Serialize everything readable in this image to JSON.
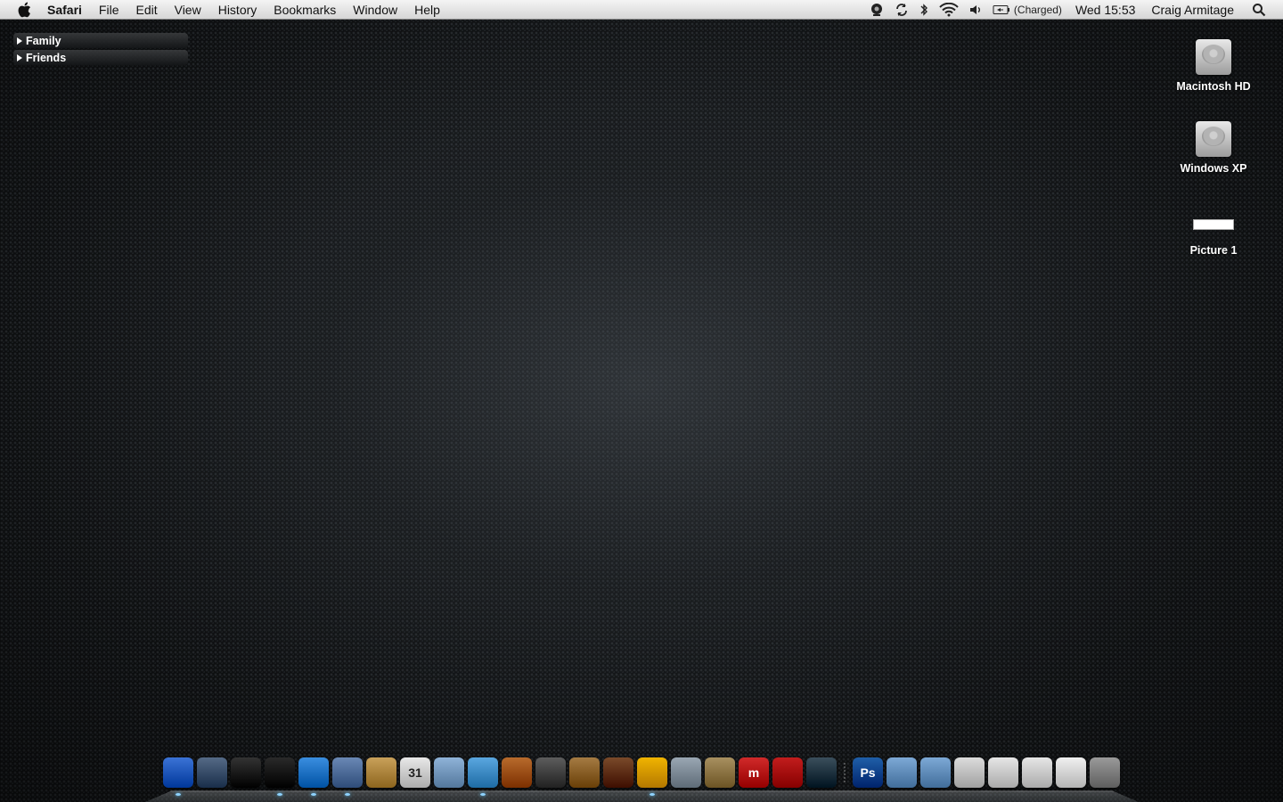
{
  "menubar": {
    "app_name": "Safari",
    "menus": [
      "File",
      "Edit",
      "View",
      "History",
      "Bookmarks",
      "Window",
      "Help"
    ],
    "battery_status": "(Charged)",
    "clock": "Wed 15:53",
    "user": "Craig Armitage"
  },
  "stack_list": {
    "items": [
      "Family",
      "Friends"
    ]
  },
  "desktop_icons": [
    {
      "label": "Macintosh HD",
      "icon": "hard-drive-icon"
    },
    {
      "label": "Windows XP",
      "icon": "hard-drive-icon"
    },
    {
      "label": "Picture 1",
      "icon": "screenshot-file-icon"
    }
  ],
  "dock": {
    "items": [
      {
        "icon": "finder-icon",
        "color": "#3b73d6",
        "running": true
      },
      {
        "icon": "dashboard-spaces-icon",
        "color": "#556a86",
        "running": false
      },
      {
        "icon": "dashboard-icon",
        "color": "#333333",
        "running": false
      },
      {
        "icon": "quicksilver-icon",
        "color": "#2a2a2a",
        "running": true
      },
      {
        "icon": "safari-icon",
        "color": "#3a8ee0",
        "running": true
      },
      {
        "icon": "mail-icon",
        "color": "#6a88b5",
        "running": true
      },
      {
        "icon": "address-book-icon",
        "color": "#c9a15a",
        "running": false
      },
      {
        "icon": "ical-icon",
        "color": "#e8e8e8",
        "glyph": "31",
        "running": false
      },
      {
        "icon": "xcode-icon",
        "color": "#8fb3d8",
        "running": false
      },
      {
        "icon": "itunes-icon",
        "color": "#5aa7e0",
        "running": true
      },
      {
        "icon": "iphoto-icon",
        "color": "#b86b2c",
        "running": false
      },
      {
        "icon": "imovie-icon",
        "color": "#5d5d5d",
        "running": false
      },
      {
        "icon": "keynote-icon",
        "color": "#a57b43",
        "running": false
      },
      {
        "icon": "garageband-icon",
        "color": "#7a4a2a",
        "running": false
      },
      {
        "icon": "chat-app-icon",
        "color": "#f0b400",
        "running": true
      },
      {
        "icon": "transmit-icon",
        "color": "#9aa7b3",
        "running": false
      },
      {
        "icon": "archive-app-icon",
        "color": "#a89060",
        "running": false
      },
      {
        "icon": "miro-icon",
        "color": "#d12a2a",
        "glyph": "m",
        "running": false
      },
      {
        "icon": "front-row-icon",
        "color": "#c21d1d",
        "running": false
      },
      {
        "icon": "time-machine-icon",
        "color": "#3b4f5c",
        "running": false
      },
      {
        "icon": "separator",
        "color": "",
        "running": false
      },
      {
        "icon": "photoshop-icon",
        "color": "#1f5fa8",
        "glyph": "Ps",
        "running": false
      },
      {
        "icon": "applications-folder-icon",
        "color": "#7da9d6",
        "running": false
      },
      {
        "icon": "documents-folder-icon",
        "color": "#7da9d6",
        "running": false
      },
      {
        "icon": "downloads-stack-icon",
        "color": "#dcdcdc",
        "running": false
      },
      {
        "icon": "minimized-window-icon",
        "color": "#e6e6e6",
        "running": false
      },
      {
        "icon": "minimized-window-icon",
        "color": "#e6e6e6",
        "running": false
      },
      {
        "icon": "minimized-window-icon",
        "color": "#f0f0f0",
        "running": false
      },
      {
        "icon": "trash-icon",
        "color": "#9a9a9a",
        "running": false
      }
    ]
  }
}
